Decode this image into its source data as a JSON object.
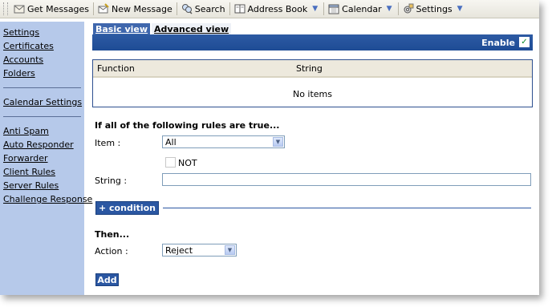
{
  "toolbar": {
    "get_messages": "Get Messages",
    "new_message": "New Message",
    "search": "Search",
    "address_book": "Address Book",
    "calendar": "Calendar",
    "settings": "Settings"
  },
  "sidebar": {
    "group1": [
      "Settings",
      "Certificates",
      "Accounts",
      "Folders"
    ],
    "group2": [
      "Calendar Settings"
    ],
    "group3": [
      "Anti Spam",
      "Auto Responder",
      "Forwarder",
      "Client Rules",
      "Server Rules",
      "Challenge Response"
    ]
  },
  "tabs": {
    "basic": "Basic view",
    "advanced": "Advanced view"
  },
  "enable": {
    "label": "Enable",
    "checked": true
  },
  "rules_table": {
    "col_function": "Function",
    "col_string": "String",
    "empty": "No items"
  },
  "conditions": {
    "title": "If all of the following rules are true...",
    "item_label": "Item :",
    "item_value": "All",
    "not_label": "NOT",
    "string_label": "String :",
    "string_value": "",
    "add_condition": "+ condition"
  },
  "then": {
    "title": "Then...",
    "action_label": "Action :",
    "action_value": "Reject",
    "add_button": "Add"
  },
  "colors": {
    "accent": "#2b57a2",
    "sidebar_bg": "#b6c9ea",
    "toolbar_bg": "#ece9d8"
  }
}
